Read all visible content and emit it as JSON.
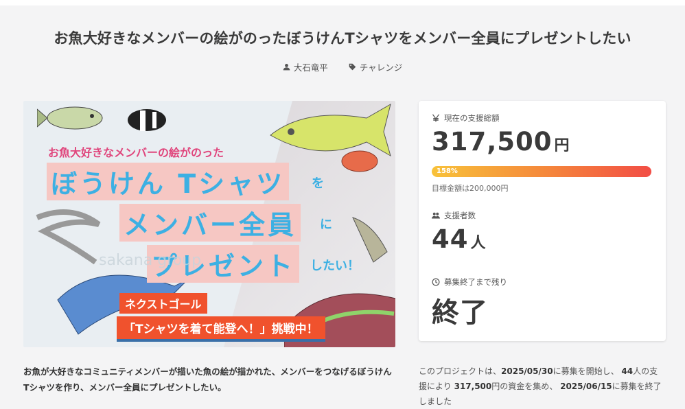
{
  "title": "お魚大好きなメンバーの絵がのったぼうけんTシャツをメンバー全員にプレゼントしたい",
  "meta": {
    "author": "大石竜平",
    "tag": "チャレンジ"
  },
  "hero": {
    "subtitle": "お魚大好きなメンバーの絵がのった",
    "line_a": "ぼうけん Tシャツ",
    "line_a_suffix": "を",
    "line_b": "メンバー全員",
    "line_b_suffix": "に",
    "line_c": "プレゼント",
    "line_c_suffix": "したい！",
    "next_goal": "ネクストゴール",
    "challenge": "「Tシャツを着て能登へ！」挑戦中！",
    "watermark": "sakana group"
  },
  "description": "お魚が大好きなコミュニティメンバーが描いた魚の絵が描かれた、メンバーをつなげるぼうけんTシャツを作り、メンバー全員にプレゼントしたい。",
  "card": {
    "total_label": "現在の支援総額",
    "total_value": "317,500",
    "total_unit": "円",
    "progress_percent": 158,
    "progress_label": "158%",
    "goal_text": "目標金額は200,000円",
    "supporters_label": "支援者数",
    "supporters_value": "44",
    "supporters_unit": "人",
    "remaining_label": "募集終了まで残り",
    "remaining_value": "終了"
  },
  "summary": {
    "p1": "このプロジェクトは、",
    "start": "2025/05/30",
    "p2": "に募集を開始し、",
    "count": "44",
    "p3": "人の支援により",
    "amount": "317,500",
    "p4": "円の資金を集め、",
    "end": "2025/06/15",
    "p5": "に募集を終了しました"
  },
  "icons": {
    "author": "user-icon",
    "tag": "tag-icon",
    "total": "yen-icon",
    "supporters": "users-icon",
    "remaining": "clock-icon"
  },
  "colors": {
    "progress_start": "#f8c23a",
    "progress_end": "#f24d45",
    "hero_text": "#3db0e3",
    "hero_band": "#f6c7c3",
    "cta_orange": "#f0522d"
  }
}
